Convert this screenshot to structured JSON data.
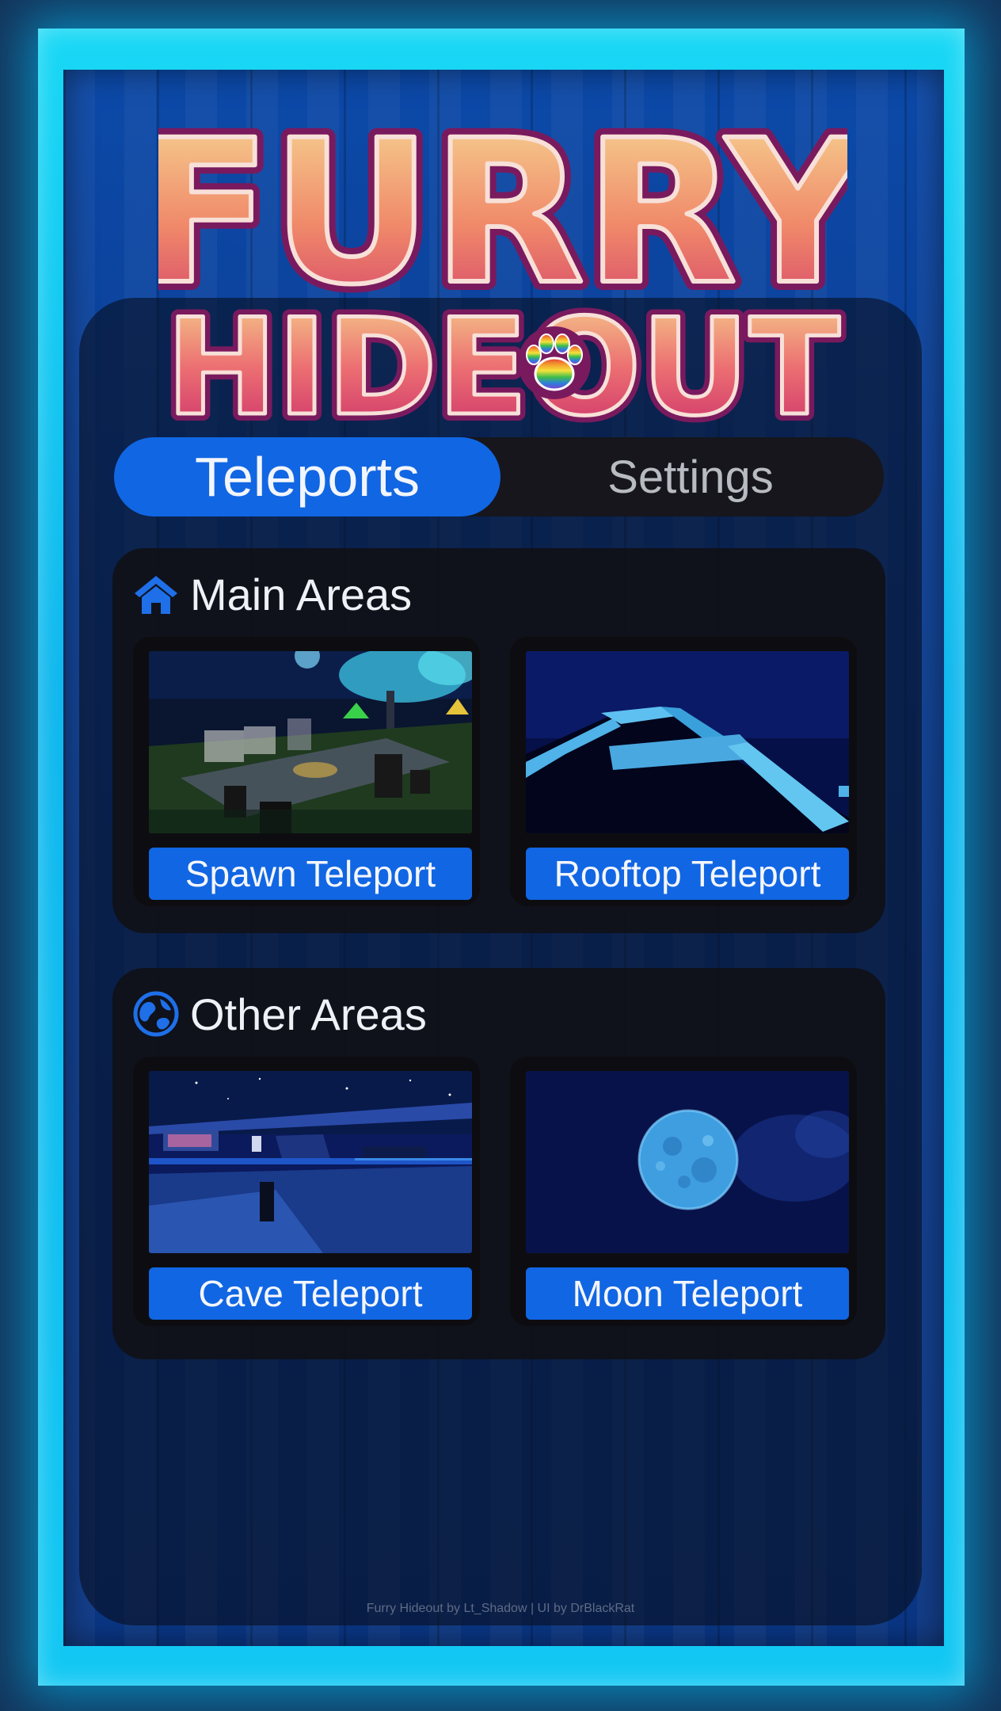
{
  "logo": {
    "line1": "FURRY",
    "line2": "HIDEOUT"
  },
  "tabs": [
    {
      "label": "Teleports",
      "active": true
    },
    {
      "label": "Settings",
      "active": false
    }
  ],
  "sections": {
    "main": {
      "title": "Main Areas",
      "icon": "home-icon",
      "items": [
        {
          "label": "Spawn Teleport",
          "thumbnail": "spawn-area-preview"
        },
        {
          "label": "Rooftop Teleport",
          "thumbnail": "rooftop-area-preview"
        }
      ]
    },
    "other": {
      "title": "Other Areas",
      "icon": "globe-icon",
      "items": [
        {
          "label": "Cave Teleport",
          "thumbnail": "cave-area-preview"
        },
        {
          "label": "Moon Teleport",
          "thumbnail": "moon-area-preview"
        }
      ]
    }
  },
  "footer": {
    "credits": "Furry Hideout by Lt_Shadow | UI by DrBlackRat"
  },
  "colors": {
    "accent": "#1166e3",
    "frame_glow": "#18d8f5",
    "board": "#0b3f95",
    "panel": "#0a0e1c"
  }
}
